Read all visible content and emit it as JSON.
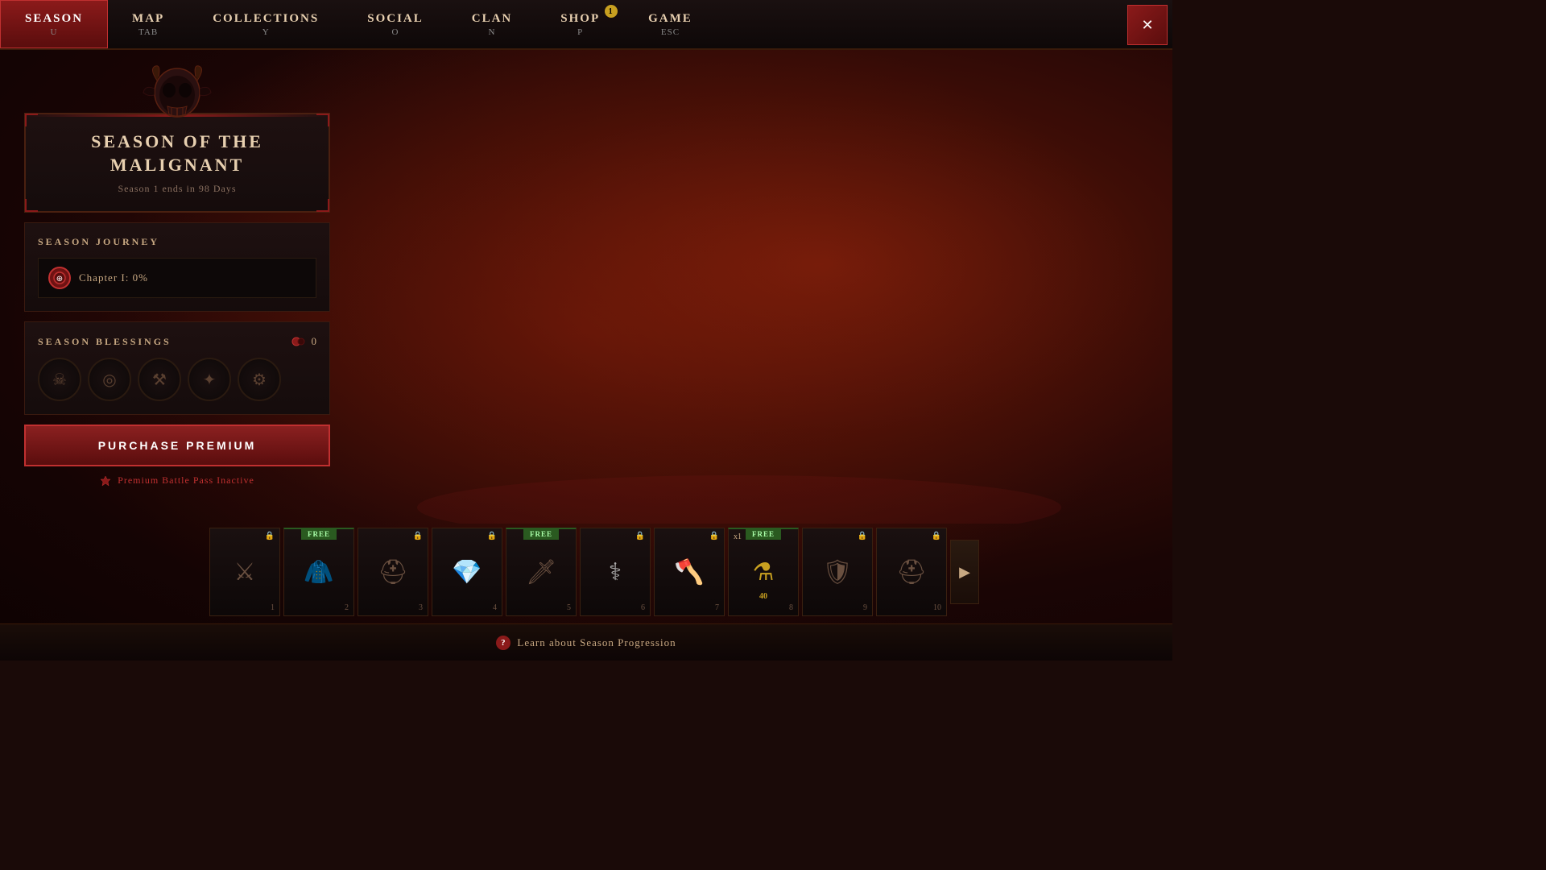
{
  "nav": {
    "items": [
      {
        "label": "SEASON",
        "key": "U",
        "active": true,
        "badge": null
      },
      {
        "label": "MAP",
        "key": "TAB",
        "active": false,
        "badge": null
      },
      {
        "label": "COLLECTIONS",
        "key": "Y",
        "active": false,
        "badge": null
      },
      {
        "label": "SOCIAL",
        "key": "O",
        "active": false,
        "badge": null
      },
      {
        "label": "CLAN",
        "key": "N",
        "active": false,
        "badge": null
      },
      {
        "label": "SHOP",
        "key": "P",
        "active": false,
        "badge": "1"
      },
      {
        "label": "GAME",
        "key": "ESC",
        "active": false,
        "badge": null
      }
    ],
    "close_label": "✕"
  },
  "season": {
    "title": "SEASON OF THE MALIGNANT",
    "subtitle": "Season 1 ends in 98 Days",
    "journey": {
      "section_title": "SEASON JOURNEY",
      "chapter_label": "Chapter I: 0%"
    },
    "blessings": {
      "section_title": "SEASON BLESSINGS",
      "count": "0"
    },
    "purchase_label": "PURCHASE PREMIUM",
    "premium_status": "Premium Battle Pass Inactive"
  },
  "bottom_items": [
    {
      "number": "1",
      "free": false,
      "x1": false,
      "type": "armor"
    },
    {
      "number": "2",
      "free": true,
      "x1": false,
      "type": "cape"
    },
    {
      "number": "3",
      "free": false,
      "x1": false,
      "type": "helm"
    },
    {
      "number": "4",
      "free": false,
      "x1": false,
      "type": "gem"
    },
    {
      "number": "5",
      "free": true,
      "x1": false,
      "type": "weapon"
    },
    {
      "number": "6",
      "free": false,
      "x1": false,
      "type": "emblem"
    },
    {
      "number": "7",
      "free": false,
      "x1": false,
      "type": "axe"
    },
    {
      "number": "8",
      "free": true,
      "x1": true,
      "type": "potion",
      "quantity": "40"
    },
    {
      "number": "9",
      "free": false,
      "x1": false,
      "type": "shield"
    },
    {
      "number": "10",
      "free": false,
      "x1": false,
      "type": "helm2"
    }
  ],
  "bottom_bar": {
    "learn_text": "Learn about Season Progression"
  },
  "colors": {
    "accent_red": "#8b1a1a",
    "border_gold": "#3a2010",
    "text_light": "#e8d0b0",
    "text_muted": "#8a7060"
  }
}
